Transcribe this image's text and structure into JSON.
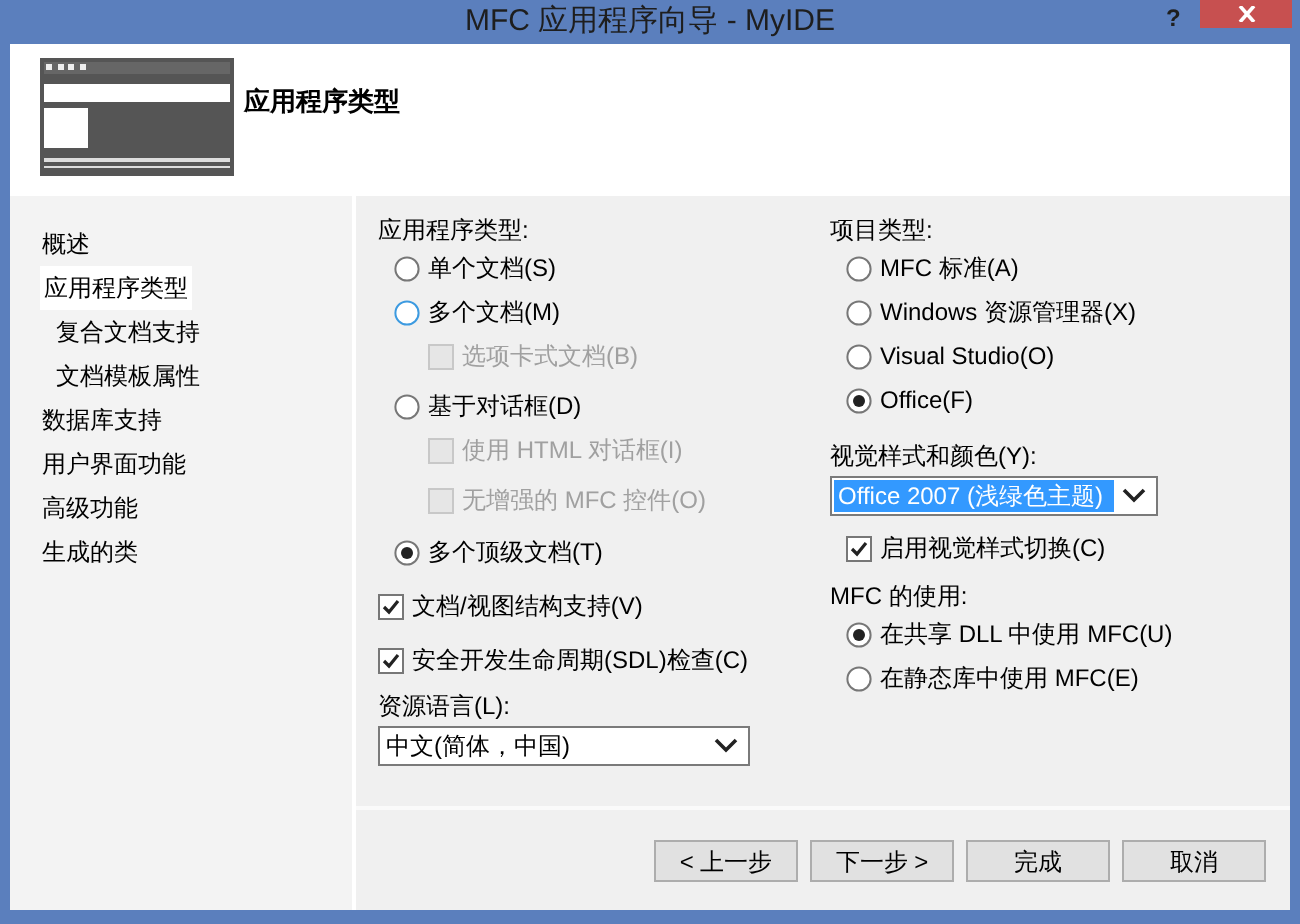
{
  "window": {
    "title": "MFC 应用程序向导 - MyIDE",
    "help": "?"
  },
  "header": {
    "title": "应用程序类型"
  },
  "nav": [
    {
      "label": "概述",
      "selected": false
    },
    {
      "label": "应用程序类型",
      "selected": true,
      "children": [
        {
          "label": "复合文档支持",
          "selected": false
        },
        {
          "label": "文档模板属性",
          "selected": false
        }
      ]
    },
    {
      "label": "数据库支持",
      "selected": false
    },
    {
      "label": "用户界面功能",
      "selected": false
    },
    {
      "label": "高级功能",
      "selected": false
    },
    {
      "label": "生成的类",
      "selected": false
    }
  ],
  "app_type": {
    "label": "应用程序类型:",
    "options": [
      {
        "kind": "radio",
        "label": "单个文档(S)",
        "selected": false,
        "focused": false
      },
      {
        "kind": "radio",
        "label": "多个文档(M)",
        "selected": false,
        "focused": true,
        "children": [
          {
            "kind": "checkbox",
            "label": "选项卡式文档(B)",
            "checked": false,
            "disabled": true
          }
        ]
      },
      {
        "kind": "radio",
        "label": "基于对话框(D)",
        "selected": false,
        "focused": false,
        "children": [
          {
            "kind": "checkbox",
            "label": "使用 HTML 对话框(I)",
            "checked": false,
            "disabled": true
          },
          {
            "kind": "checkbox",
            "label": "无增强的 MFC 控件(O)",
            "checked": false,
            "disabled": true
          }
        ]
      },
      {
        "kind": "radio",
        "label": "多个顶级文档(T)",
        "selected": true,
        "focused": false
      }
    ]
  },
  "options": [
    {
      "label": "文档/视图结构支持(V)",
      "checked": true
    },
    {
      "label": "安全开发生命周期(SDL)检查(C)",
      "checked": true
    }
  ],
  "resource_language": {
    "label": "资源语言(L):",
    "value": "中文(简体，中国)",
    "focused": false
  },
  "project_type": {
    "label": "项目类型:",
    "options": [
      {
        "label": "MFC 标准(A)",
        "selected": false
      },
      {
        "label": "Windows 资源管理器(X)",
        "selected": false
      },
      {
        "label": "Visual Studio(O)",
        "selected": false
      },
      {
        "label": "Office(F)",
        "selected": true
      }
    ]
  },
  "visual_style": {
    "label": "视觉样式和颜色(Y):",
    "value": "Office 2007 (浅绿色主题)",
    "focused": true
  },
  "style_switch": {
    "label": "启用视觉样式切换(C)",
    "checked": true
  },
  "mfc_use": {
    "label": "MFC 的使用:",
    "options": [
      {
        "label": "在共享 DLL 中使用 MFC(U)",
        "selected": true
      },
      {
        "label": "在静态库中使用 MFC(E)",
        "selected": false
      }
    ]
  },
  "buttons": [
    {
      "label": "< 上一步"
    },
    {
      "label": "下一步 >"
    },
    {
      "label": "完成"
    },
    {
      "label": "取消"
    }
  ]
}
